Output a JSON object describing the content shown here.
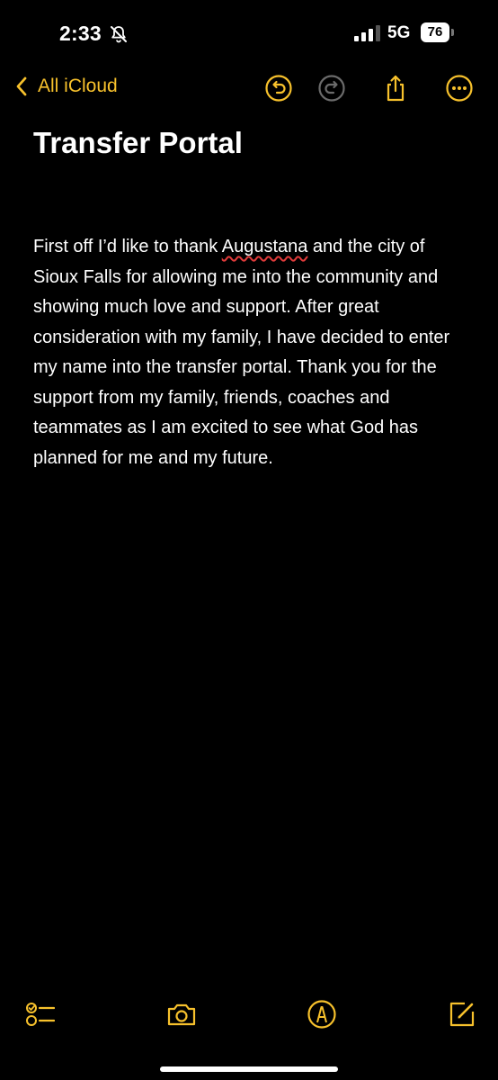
{
  "status": {
    "time": "2:33",
    "network": "5G",
    "battery": "76"
  },
  "nav": {
    "back_label": "All iCloud",
    "icons": [
      "undo-icon",
      "redo-icon",
      "share-icon",
      "more-icon"
    ]
  },
  "note": {
    "title": "Transfer Portal",
    "body_part1": "First off I’d like to thank ",
    "misspelled_word": "Augustana",
    "body_part2": " and the city of Sioux Falls for allowing me into the community and showing much love and support. After great consideration with my family, I have decided to enter my name into the transfer portal. Thank you for the support from my family, friends, coaches and teammates as I am excited to see what God has planned for me and my future."
  },
  "toolbar": {
    "icons": [
      "checklist-icon",
      "camera-icon",
      "markup-icon",
      "compose-icon"
    ]
  },
  "colors": {
    "accent": "#f7c12c",
    "background": "#000000",
    "text": "#ffffff",
    "spellcheck": "#e23b3b"
  }
}
